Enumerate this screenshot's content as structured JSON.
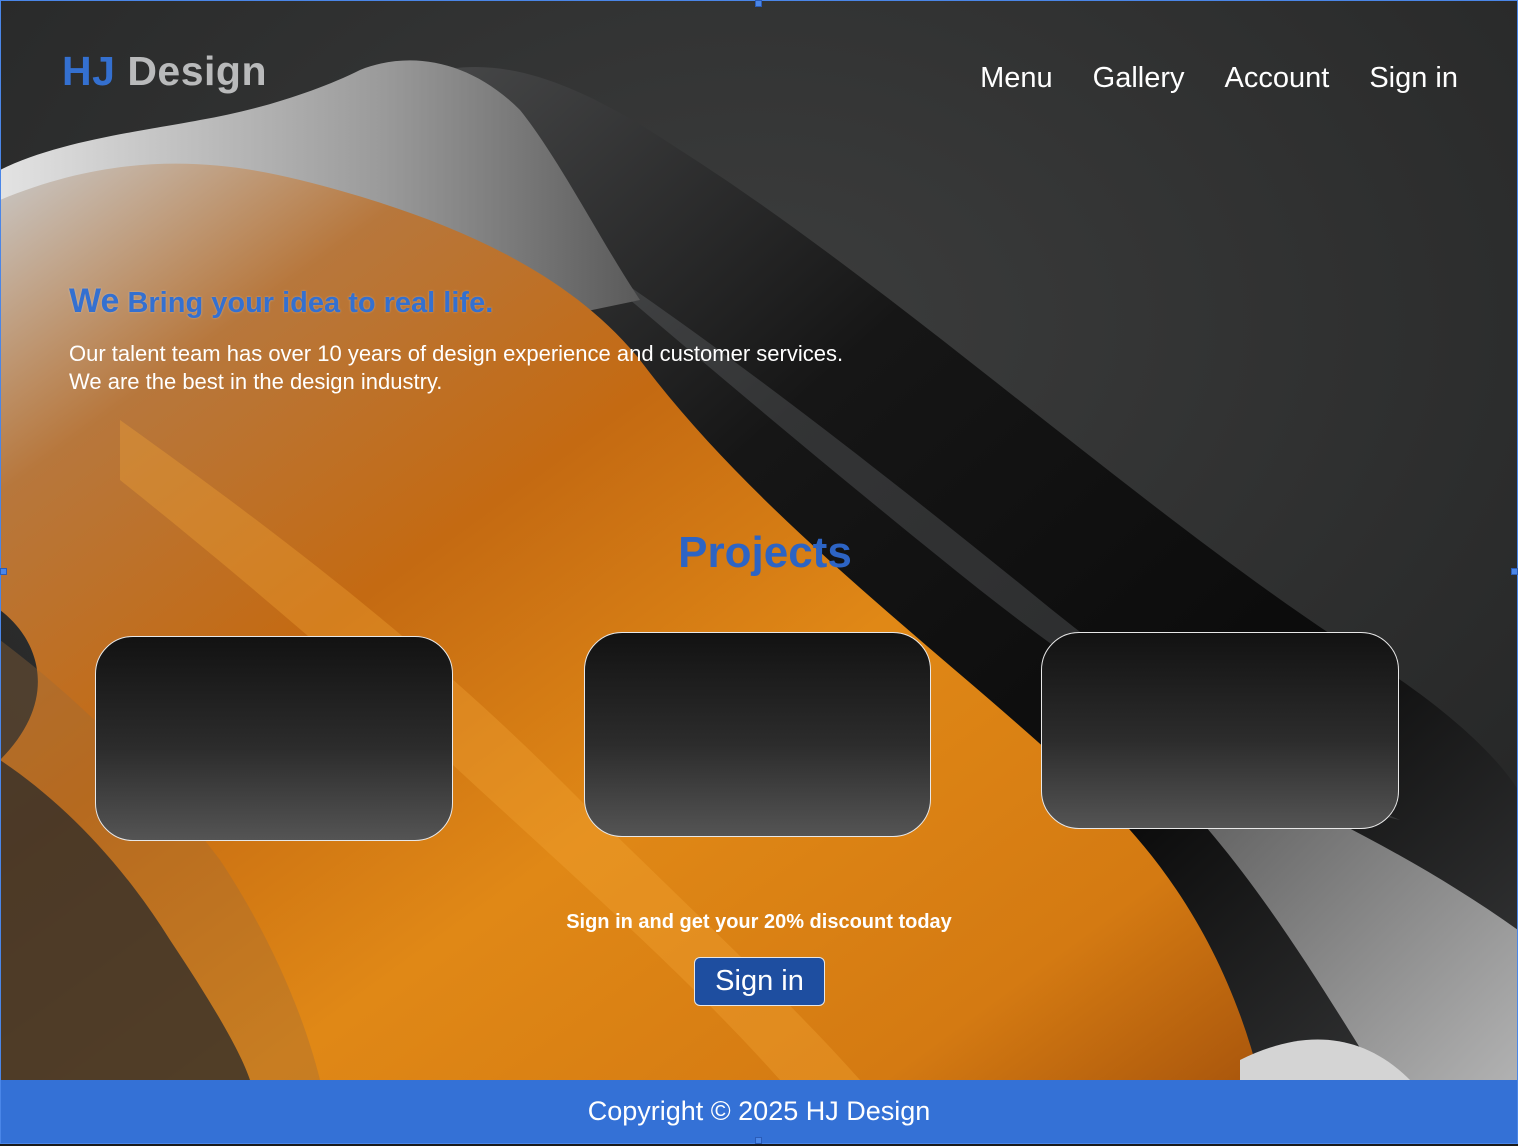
{
  "header": {
    "logo_primary": "HJ",
    "logo_secondary": "Design",
    "nav": [
      {
        "label": "Menu"
      },
      {
        "label": "Gallery"
      },
      {
        "label": "Account"
      },
      {
        "label": "Sign in"
      }
    ]
  },
  "hero": {
    "title_lead": "We",
    "title_rest": "Bring your idea to real life.",
    "line1": "Our talent team has over 10 years of design experience and customer services.",
    "line2": "We are the best in the design industry."
  },
  "projects": {
    "title": "Projects",
    "card_count": 3
  },
  "promo": {
    "text": "Sign in and get your 20% discount today",
    "button_label": "Sign in"
  },
  "footer": {
    "text": "Copyright © 2025 HJ Design"
  },
  "colors": {
    "brand_blue": "#3470d0",
    "footer_blue": "#3471d6",
    "button_blue": "#1e4ea0",
    "accent_orange": "#d9791a"
  }
}
